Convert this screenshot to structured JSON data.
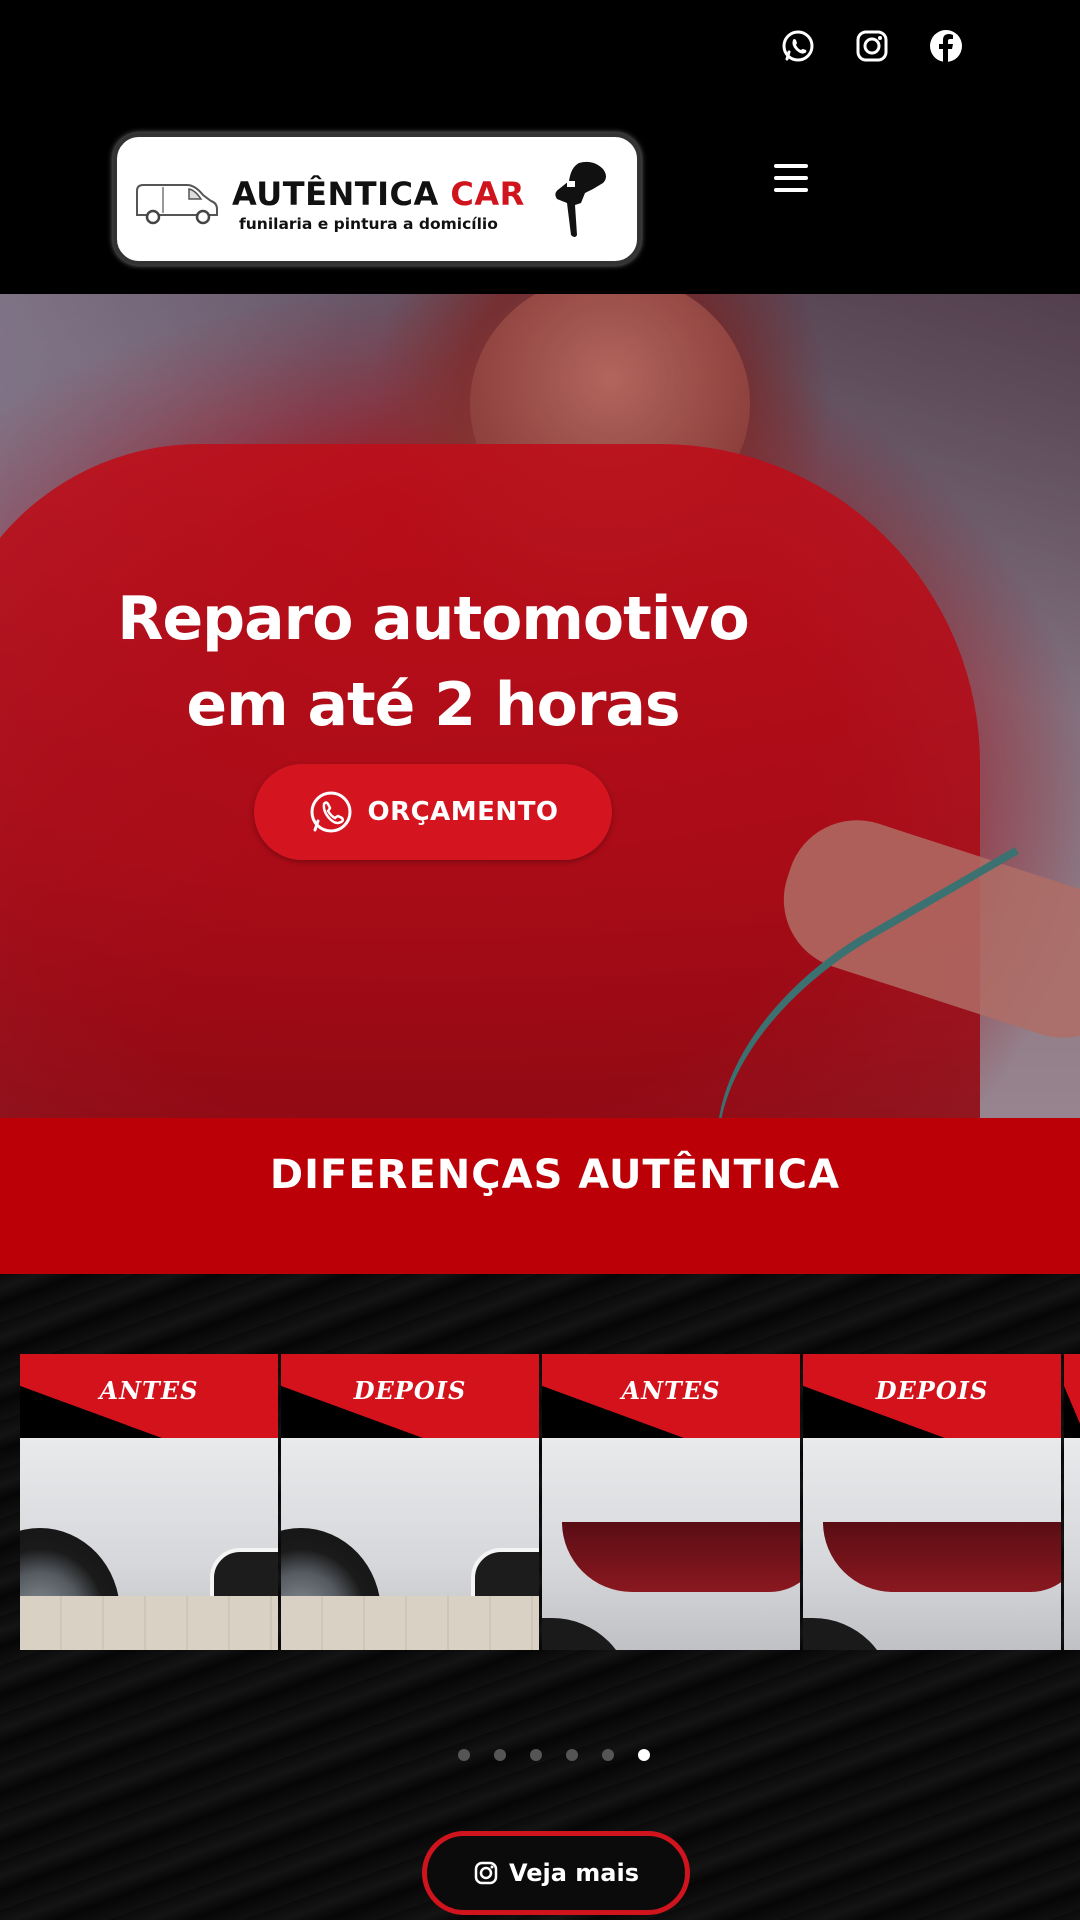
{
  "social": {
    "icons": [
      "whatsapp-icon",
      "instagram-icon",
      "facebook-icon"
    ]
  },
  "header": {
    "logo_title_main": "AUTÊNTICA ",
    "logo_title_accent": "CAR",
    "logo_subtitle": "funilaria e pintura a domicílio"
  },
  "hero": {
    "headline_line1": "Reparo automotivo",
    "headline_line2": "em até 2 horas",
    "cta_label": "ORÇAMENTO"
  },
  "section": {
    "title": "DIFERENÇAS AUTÊNTICA"
  },
  "gallery": {
    "slides": [
      {
        "label": "ANTES"
      },
      {
        "label": "DEPOIS"
      },
      {
        "label": "ANTES"
      },
      {
        "label": "DEPOIS"
      }
    ],
    "dots_count": 6,
    "active_dot": 6,
    "more_label": "Veja mais"
  },
  "colors": {
    "brand_red": "#d41520",
    "band_red": "#bc0008",
    "background": "#000000"
  }
}
